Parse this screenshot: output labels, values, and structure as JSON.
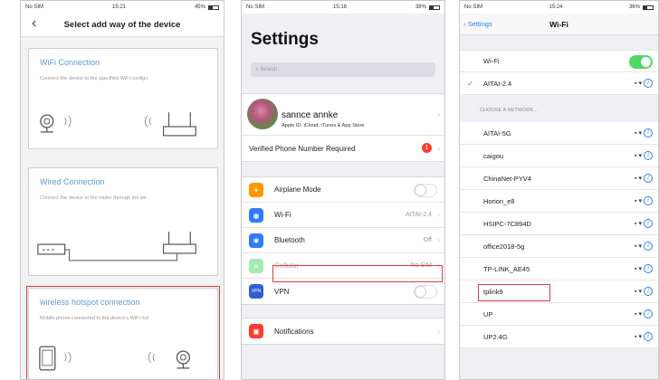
{
  "phone1": {
    "status": {
      "carrier": "No SIM",
      "time": "15:21",
      "battery": "45%"
    },
    "title": "Select add way of the device",
    "cards": [
      {
        "title": "WiFi Connection",
        "desc": "Connect the device to the specified WiFi configu"
      },
      {
        "title": "Wired Connection",
        "desc": "Connect the device to the router through the wir"
      },
      {
        "title": "wireless hotspot connection",
        "desc": "Mobile phone connected to the device's WiFi hot"
      }
    ]
  },
  "phone2": {
    "status": {
      "carrier": "No SIM",
      "time": "15:18",
      "battery": "38%"
    },
    "title": "Settings",
    "search_placeholder": "Search",
    "profile": {
      "name": "sannce annke",
      "sub": "Apple ID, iCloud, iTunes & App Store"
    },
    "verified": {
      "label": "Verified Phone Number Required",
      "badge": "1"
    },
    "rows": [
      {
        "label": "Airplane Mode",
        "value": "",
        "color": "#ff9500",
        "icon": "airplane-icon"
      },
      {
        "label": "Wi-Fi",
        "value": "AITAI-2.4",
        "color": "#2f7cf6",
        "icon": "wifi-icon"
      },
      {
        "label": "Bluetooth",
        "value": "Off",
        "color": "#2f7cf6",
        "icon": "bluetooth-icon"
      },
      {
        "label": "Cellular",
        "value": "No SIM",
        "color": "#4cd964",
        "icon": "cellular-icon"
      },
      {
        "label": "VPN",
        "value": "",
        "color": "#2f5fd6",
        "icon": "vpn-icon"
      }
    ],
    "notifications": "Notifications"
  },
  "phone3": {
    "status": {
      "carrier": "No SIM",
      "time": "15:24",
      "battery": "36%"
    },
    "back": "Settings",
    "title": "Wi-Fi",
    "wifi_label": "Wi-Fi",
    "connected": "AITAI-2.4",
    "section": "CHOOSE A NETWORK...",
    "networks": [
      "AITAI-5G",
      "caigou",
      "ChinaNet-PYV4",
      "Horion_e8",
      "HSIPC-7C894D",
      "office2018-5g",
      "TP-LINK_AE45",
      "tplink9",
      "UP",
      "UP2.4G"
    ],
    "highlight_color": "#e23b3b"
  }
}
